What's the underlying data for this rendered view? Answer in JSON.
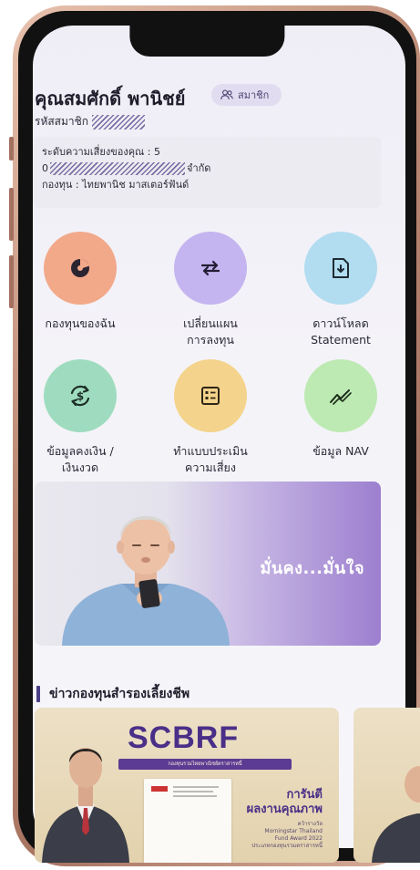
{
  "header": {
    "name": "คุณสมศักดิ์ พานิชย์",
    "member_badge": "สมาชิก",
    "member_id_label": "รหัสสมาชิก"
  },
  "info": {
    "risk_level": "ระดับความเสี่ยงของคุณ : 5",
    "company_prefix": "0",
    "company_suffix": "จำกัด",
    "fund": "กองทุน : ไทยพานิช มาสเตอร์ฟันด์"
  },
  "menu": [
    {
      "label1": "กองทุนของฉัน",
      "label2": "",
      "icon": "pie-chart-icon",
      "color": "#f2a98a"
    },
    {
      "label1": "เปลี่ยนแผน",
      "label2": "การลงทุน",
      "icon": "switch-arrows-icon",
      "color": "#c4b4ef"
    },
    {
      "label1": "ดาวน์โหลด",
      "label2": "Statement",
      "icon": "download-document-icon",
      "color": "#b2dcef"
    },
    {
      "label1": "ข้อมูลคงเงิน /",
      "label2": "เงินงวด",
      "icon": "money-cycle-icon",
      "color": "#9fdcbf"
    },
    {
      "label1": "ทำแบบประเมิน",
      "label2": "ความเสี่ยง",
      "icon": "form-icon",
      "color": "#f4d38c"
    },
    {
      "label1": "ข้อมูล NAV",
      "label2": "",
      "icon": "trend-line-icon",
      "color": "#bdeab3"
    }
  ],
  "banner": {
    "text": "มั่นคง...มั่นใจ"
  },
  "news": {
    "title": "ข่าวกองทุนสำรองเลี้ยงชีพ",
    "card": {
      "brand": "SCBRF",
      "subtitle": "กองทุนรวมไทยพาณิชย์ตราสารหนี้",
      "headline1": "การันตี",
      "headline2": "ผลงานคุณภาพ",
      "award1": "คว้ารางวัล",
      "award2": "Morningstar Thailand",
      "award3": "Fund Award 2022",
      "award4": "ประเภทกองทุนรวมตราสารหนี้"
    }
  },
  "colors": {
    "accent": "#4a3f86",
    "badge_bg": "#e2dcf1"
  }
}
